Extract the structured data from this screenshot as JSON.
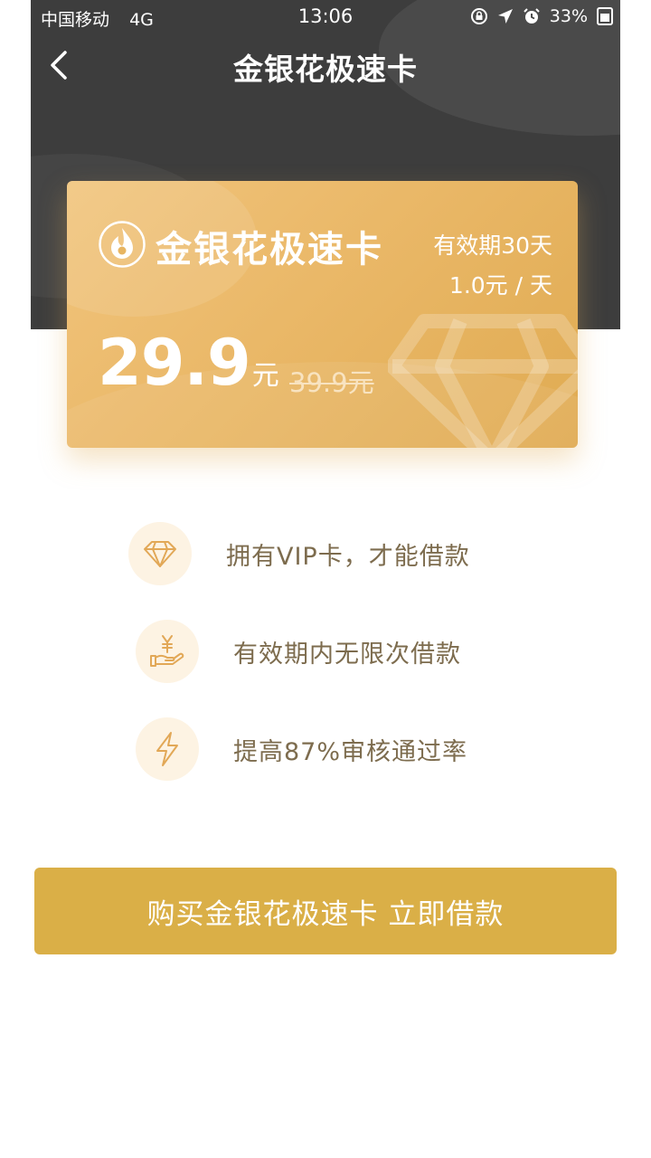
{
  "status_bar": {
    "carrier": "中国移动",
    "network": "4G",
    "time": "13:06",
    "battery": "33%"
  },
  "nav": {
    "title": "金银花极速卡"
  },
  "card": {
    "name": "金银花极速卡",
    "validity": "有效期30天",
    "per_day": "1.0元 / 天",
    "price": "29.9",
    "price_unit": "元",
    "original_price": "39.9元"
  },
  "features": [
    {
      "icon": "diamond-icon",
      "text": "拥有VIP卡，才能借款"
    },
    {
      "icon": "hand-yuan-icon",
      "text": "有效期内无限次借款"
    },
    {
      "icon": "lightning-icon",
      "text": "提高87%审核通过率"
    }
  ],
  "buy_button": {
    "label": "购买金银花极速卡 立即借款"
  },
  "colors": {
    "header_bg": "#3d3d3d",
    "card_gold": "#eab868",
    "button_gold": "#daaf47",
    "feature_text": "#7d6c4e",
    "icon_circle": "#fdf3e3",
    "icon_stroke": "#e2a857"
  }
}
